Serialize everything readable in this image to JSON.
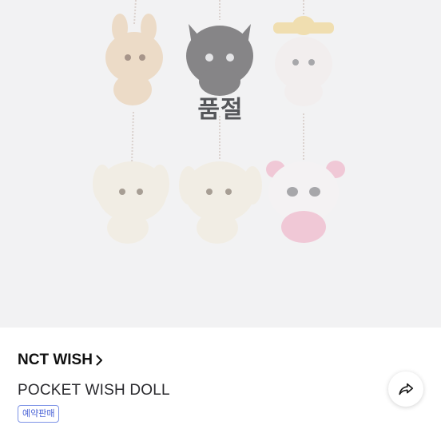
{
  "product": {
    "image_alt": "NCT WISH pocket doll keyrings",
    "status_overlay": "품절",
    "brand": "NCT WISH",
    "name": "POCKET WISH DOLL",
    "badge": "예약판매"
  },
  "icons": {
    "brand_chevron": "chevron-right-icon",
    "share": "share-arrow-icon"
  },
  "colors": {
    "image_bg": "#f2f2f3",
    "badge_text": "#4a63d6",
    "badge_border": "#7d93e6"
  }
}
